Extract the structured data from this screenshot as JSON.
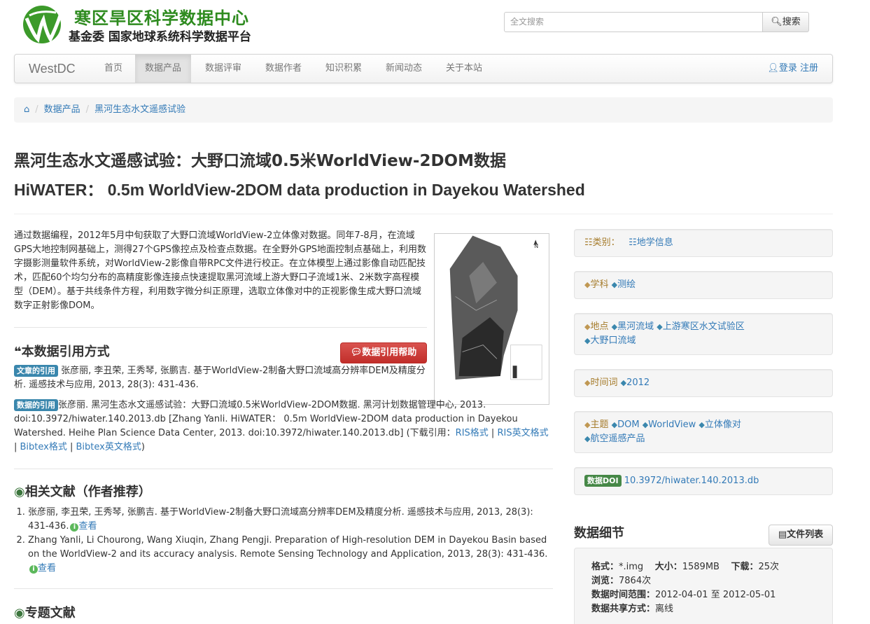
{
  "header": {
    "site_title": "寒区旱区科学数据中心",
    "site_subtitle": "基金委 国家地球系统科学数据平台",
    "search_placeholder": "全文搜索",
    "search_button": "搜索"
  },
  "navbar": {
    "brand": "WestDC",
    "items": [
      "首页",
      "数据产品",
      "数据评审",
      "数据作者",
      "知识积累",
      "新闻动态",
      "关于本站"
    ],
    "active_index": 1,
    "login": "登录",
    "register": "注册"
  },
  "breadcrumb": {
    "items": [
      "数据产品",
      "黑河生态水文遥感试验"
    ]
  },
  "title": {
    "zh": "黑河生态水文遥感试验：大野口流域0.5米WorldView-2DOM数据",
    "en": "HiWATER： 0.5m WorldView-2DOM data production in Dayekou Watershed"
  },
  "abstract": "通过数据编程，2012年5月中旬获取了大野口流域WorldView-2立体像对数据。同年7-8月，在流域GPS大地控制网基础上，测得27个GPS像控点及检查点数据。在全野外GPS地面控制点基础上，利用数字摄影测量软件系统，对WorldView-2影像自带RPC文件进行校正。在立体模型上通过影像自动匹配技术，匹配60个均匀分布的高精度影像连接点快速提取黑河流域上游大野口子流域1米、2米数字高程模型（DEM）。基于共线条件方程，利用数字微分纠正原理，选取立体像对中的正视影像生成大野口流域数字正射影像DOM。",
  "citation": {
    "section_title": "本数据引用方式",
    "help_button": "数据引用帮助",
    "article_label": "文章的引用",
    "article_text": "张彦丽, 李丑荣, 王秀琴, 张鹏吉. 基于WorldView-2制备大野口流域高分辨率DEM及精度分析. 遥感技术与应用, 2013, 28(3): 431-436.",
    "data_label": "数据的引用",
    "data_text": "张彦丽. 黑河生态水文遥感试验：大野口流域0.5米WorldView-2DOM数据. 黑河计划数据管理中心, 2013. doi:10.3972/hiwater.140.2013.db [Zhang Yanli. HiWATER： 0.5m WorldView-2DOM data production in Dayekou Watershed. Heihe Plan Science Data Center, 2013. doi:10.3972/hiwater.140.2013.db] (下载引用：",
    "links": [
      "RIS格式",
      "RIS英文格式",
      "Bibtex格式",
      "Bibtex英文格式"
    ],
    "close": ")"
  },
  "related": {
    "section_title": "相关文献（作者推荐）",
    "items": [
      "张彦丽, 李丑荣, 王秀琴, 张鹏吉. 基于WorldView-2制备大野口流域高分辨率DEM及精度分析. 遥感技术与应用, 2013, 28(3): 431-436.",
      "Zhang Yanli, Li Chourong, Wang Xiuqin, Zhang Pengji. Preparation of High-resolution DEM in Dayekou Basin based on the WorldView-2 and its accuracy analysis. Remote Sensing Technology and Application, 2013, 28(3): 431-436."
    ],
    "view_label": "查看"
  },
  "topic": {
    "section_title": "专题文献"
  },
  "sidebar": {
    "category_label": "类别：",
    "category_value": "地学信息",
    "discipline_label": "学科",
    "discipline_tags": [
      "测绘"
    ],
    "place_label": "地点",
    "place_tags": [
      "黑河流域",
      "上游寒区水文试验区",
      "大野口流域"
    ],
    "time_label": "时间词",
    "time_tags": [
      "2012"
    ],
    "theme_label": "主题",
    "theme_tags": [
      "DOM",
      "WorldView",
      "立体像对",
      "航空遥感产品"
    ],
    "doi_label": "数据DOI",
    "doi_value": "10.3972/hiwater.140.2013.db"
  },
  "details": {
    "title": "数据细节",
    "file_button": "文件列表",
    "format_label": "格式：",
    "format_value": "*.img",
    "size_label": "大小：",
    "size_value": "1589MB",
    "downloads_label": "下载：",
    "downloads_value": "25次",
    "views_label": "浏览：",
    "views_value": "7864次",
    "time_label": "数据时间范围：",
    "time_value": "2012-04-01 至 2012-05-01",
    "share_label": "数据共享方式：",
    "share_value": "离线"
  },
  "colors": {
    "logo_green": "#2e8b1f",
    "link": "#337ab7",
    "danger": "#d9534f",
    "label_info": "#3a87ad",
    "label_success": "#468847"
  }
}
